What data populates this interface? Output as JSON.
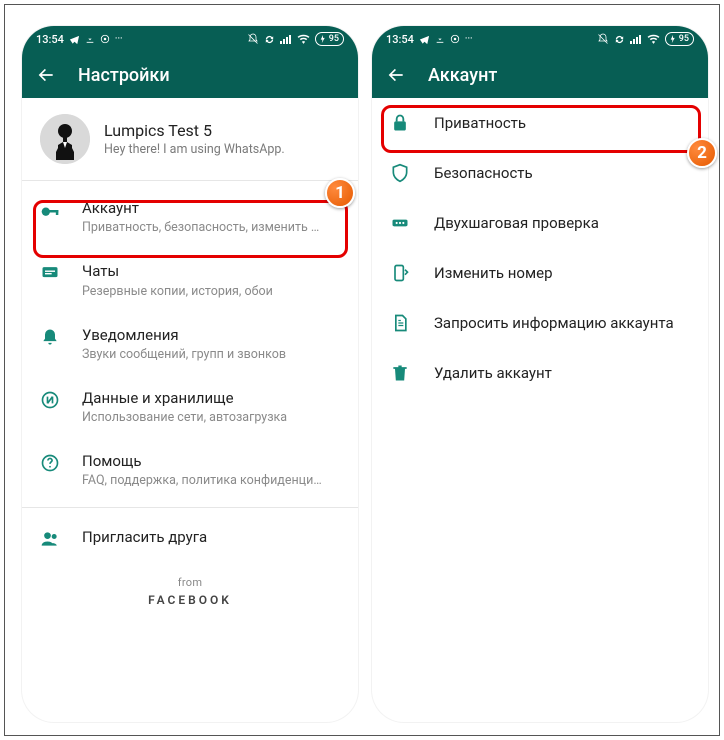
{
  "statusbar": {
    "time": "13:54",
    "battery": "95"
  },
  "settings": {
    "title": "Настройки",
    "profile": {
      "name": "Lumpics Test 5",
      "status": "Hey there! I am using WhatsApp."
    },
    "items": [
      {
        "title": "Аккаунт",
        "sub": "Приватность, безопасность, изменить номер"
      },
      {
        "title": "Чаты",
        "sub": "Резервные копии, история, обои"
      },
      {
        "title": "Уведомления",
        "sub": "Звуки сообщений, групп и звонков"
      },
      {
        "title": "Данные и хранилище",
        "sub": "Использование сети, автозагрузка"
      },
      {
        "title": "Помощь",
        "sub": "FAQ, поддержка, политика конфиденциальн..."
      },
      {
        "title": "Пригласить друга",
        "sub": ""
      }
    ],
    "from_label": "from",
    "from_brand": "FACEBOOK"
  },
  "account": {
    "title": "Аккаунт",
    "items": [
      {
        "title": "Приватность"
      },
      {
        "title": "Безопасность"
      },
      {
        "title": "Двухшаговая проверка"
      },
      {
        "title": "Изменить номер"
      },
      {
        "title": "Запросить информацию аккаунта"
      },
      {
        "title": "Удалить аккаунт"
      }
    ]
  },
  "steps": {
    "one": "1",
    "two": "2"
  }
}
